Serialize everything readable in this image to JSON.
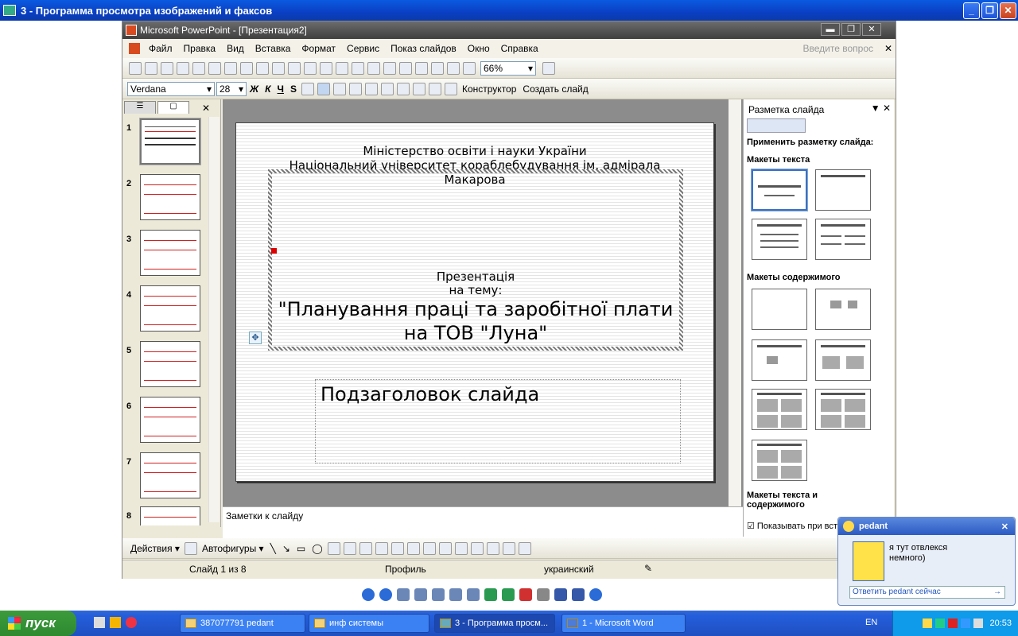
{
  "viewer": {
    "title": "3 - Программа просмотра изображений и факсов"
  },
  "ppt": {
    "title": "Microsoft PowerPoint - [Презентация2]",
    "menu": [
      "Файл",
      "Правка",
      "Вид",
      "Вставка",
      "Формат",
      "Сервис",
      "Показ слайдов",
      "Окно",
      "Справка"
    ],
    "help_placeholder": "Введите вопрос",
    "zoom": "66%",
    "font_name": "Verdana",
    "font_size": "28",
    "fmt_bold": "Ж",
    "fmt_italic": "К",
    "fmt_underline": "Ч",
    "fmt_shadow": "S",
    "designer_label": "Конструктор",
    "new_slide_label": "Создать слайд",
    "slide_numbers": [
      "1",
      "2",
      "3",
      "4",
      "5",
      "6",
      "7",
      "8"
    ],
    "slide": {
      "ministry_line1": "Міністерство освіти і науки України",
      "ministry_line2": "Національний університет кораблебудування ім. адмірала",
      "ministry_line3": "Макарова",
      "pres_line1": "Презентація",
      "pres_line2": "на тему:",
      "topic_line1": "\"Планування праці та заробітної плати",
      "topic_line2": "на ТОВ \"Луна\"",
      "subtitle_placeholder": "Подзаголовок слайда"
    },
    "notes_placeholder": "Заметки к слайду",
    "taskpane": {
      "title": "Разметка слайда",
      "apply_label": "Применить разметку слайда:",
      "group_text": "Макеты текста",
      "group_content": "Макеты содержимого",
      "group_text_content": "Макеты текста и содержимого",
      "show_on_insert": "Показывать при вст"
    },
    "drawbar": {
      "actions": "Действия",
      "autoshapes": "Автофигуры"
    },
    "status": {
      "slide": "Слайд 1 из 8",
      "design": "Профиль",
      "lang": "украинский"
    }
  },
  "taskbar": {
    "start": "пуск",
    "tasks": [
      "387077791 pedant",
      "инф системы",
      "3 - Программа просм...",
      "1 - Microsoft Word"
    ],
    "lang": "EN",
    "time": "20:53"
  },
  "popup": {
    "name": "pedant",
    "message_line1": "я тут отвлекся",
    "message_line2": "немного)",
    "reply": "Ответить pedant сейчас"
  }
}
